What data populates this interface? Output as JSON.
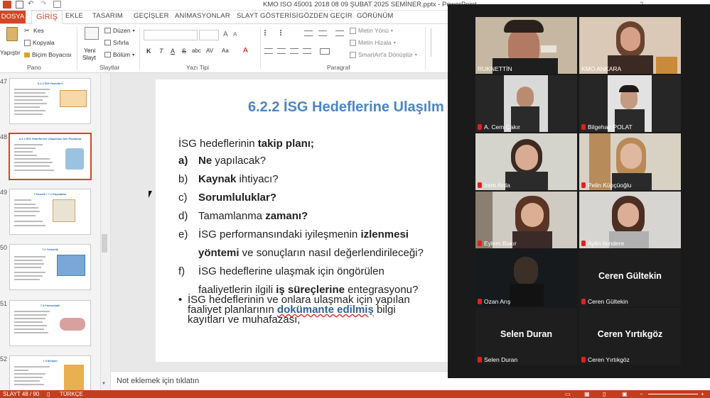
{
  "window": {
    "title": "KMO ISO 45001 2018 08 09 ŞUBAT 2025 SEMİNER.pptx - PowerPoint"
  },
  "tabs": [
    "DOSYA",
    "GİRİŞ",
    "EKLE",
    "TASARIM",
    "GEÇİŞLER",
    "ANİMASYONLAR",
    "SLAYT GÖSTERİSİ",
    "GÖZDEN GEÇİR",
    "GÖRÜNÜM"
  ],
  "ribbon": {
    "paste": "Yapıştır",
    "cut": "Kes",
    "copy": "Kopyala",
    "format_painter": "Biçim Boyacısı",
    "group_clipboard": "Pano",
    "new_slide_1": "Yeni",
    "new_slide_2": "Slayt",
    "layout": "Düzen",
    "reset": "Sıfırla",
    "section": "Bölüm",
    "group_slides": "Slaytlar",
    "group_font": "Yazı Tipi",
    "text_direction": "Metin Yönü",
    "align_text": "Metin Hizala",
    "smartart": "SmartArt'a Dönüştür",
    "group_paragraph": "Paragraf",
    "font_bold": "K",
    "font_italic": "T",
    "font_underline": "A",
    "font_strike": "S",
    "font_shadow": "abc",
    "font_spacing": "AV",
    "font_case": "Aa",
    "font_color": "A",
    "grow_font": "A",
    "shrink_font": "A"
  },
  "thumbnails": [
    {
      "num": "47",
      "title": "6.2.2 İSG Hedefleri"
    },
    {
      "num": "48",
      "title": "6.2.2 İSG Hedeflerine Ulaşılması İçin Planlama",
      "selected": true
    },
    {
      "num": "49",
      "title": "7 Destek / 7.1 Kaynaklar"
    },
    {
      "num": "50",
      "title": "7.2 Yetkinlik"
    },
    {
      "num": "51",
      "title": "7.3 Farkındalık"
    },
    {
      "num": "52",
      "title": "7.4 İletişim"
    }
  ],
  "slide": {
    "title": "6.2.2 İSG Hedeflerine Ulaşılm",
    "intro_plain": "İSG hedeflerinin ",
    "intro_bold": "takip planı;",
    "items": [
      {
        "label": "a)",
        "pre": "",
        "bold": "Ne",
        "post": " yapılacak?",
        "label_bold": true
      },
      {
        "label": "b)",
        "pre": "",
        "bold": "Kaynak",
        "post": " ihtiyacı?"
      },
      {
        "label": "c)",
        "pre": "",
        "bold": "Sorumluluklar?",
        "post": ""
      },
      {
        "label": "d)",
        "pre": "Tamamlanma ",
        "bold": "zamanı?",
        "post": ""
      },
      {
        "label": "e)",
        "pre": "İSG performansındaki iyileşmenin ",
        "bold": "izlenmesi",
        "post": ""
      },
      {
        "label": "",
        "pre": "",
        "bold": "yöntemi",
        "post": " ve sonuçların nasıl değerlendirileceği?"
      },
      {
        "label": "f)",
        "pre": "İSG hedeflerine ulaşmak için öngörülen",
        "bold": "",
        "post": ""
      },
      {
        "label": "",
        "pre": "faaliyetlerin ilgili ",
        "bold": "iş süreçlerine",
        "post": " entegrasyonu?"
      }
    ],
    "bullet_line1": "İSG hedeflerinin ve onlara ulaşmak için yapılan",
    "bullet_line2_pre": "faaliyet planlarının ",
    "bullet_line2_bold": "dokümante edilmiş",
    "bullet_line2_post": " bilgi",
    "bullet_line3": "kayıtları ve muhafazası,"
  },
  "notes": {
    "placeholder": "Not eklemek için tıklatın"
  },
  "status": {
    "slide": "SLAYT 48 / 90",
    "language": "TÜRKÇE"
  },
  "participants": [
    {
      "name": "RUKNETTİN",
      "big": "",
      "active": true,
      "muted": false
    },
    {
      "name": "KMO ANKARA",
      "big": "",
      "muted": false
    },
    {
      "name": "A. Cem Çakır",
      "big": "",
      "muted": true
    },
    {
      "name": "Bilgehan POLAT",
      "big": "",
      "muted": true
    },
    {
      "name": "İrem Arda",
      "big": "",
      "muted": true
    },
    {
      "name": "Pelin Küpçüoğlu",
      "big": "",
      "muted": true
    },
    {
      "name": "Eylem Bakır",
      "big": "",
      "muted": true
    },
    {
      "name": "Aylin Isındere",
      "big": "",
      "muted": true
    },
    {
      "name": "Ozan Arış",
      "big": "",
      "muted": true
    },
    {
      "name": "Ceren Gültekin",
      "big": "Ceren Gültekin",
      "muted": true
    },
    {
      "name": "Selen Duran",
      "big": "Selen Duran",
      "muted": true
    },
    {
      "name": "Ceren Yırtıkgöz",
      "big": "Ceren Yırtıkgöz",
      "muted": true
    }
  ],
  "colors": {
    "accent": "#d24726",
    "slide_title": "#4a86c5",
    "active_speaker": "#6ac25a",
    "mute_red": "#e02020"
  }
}
